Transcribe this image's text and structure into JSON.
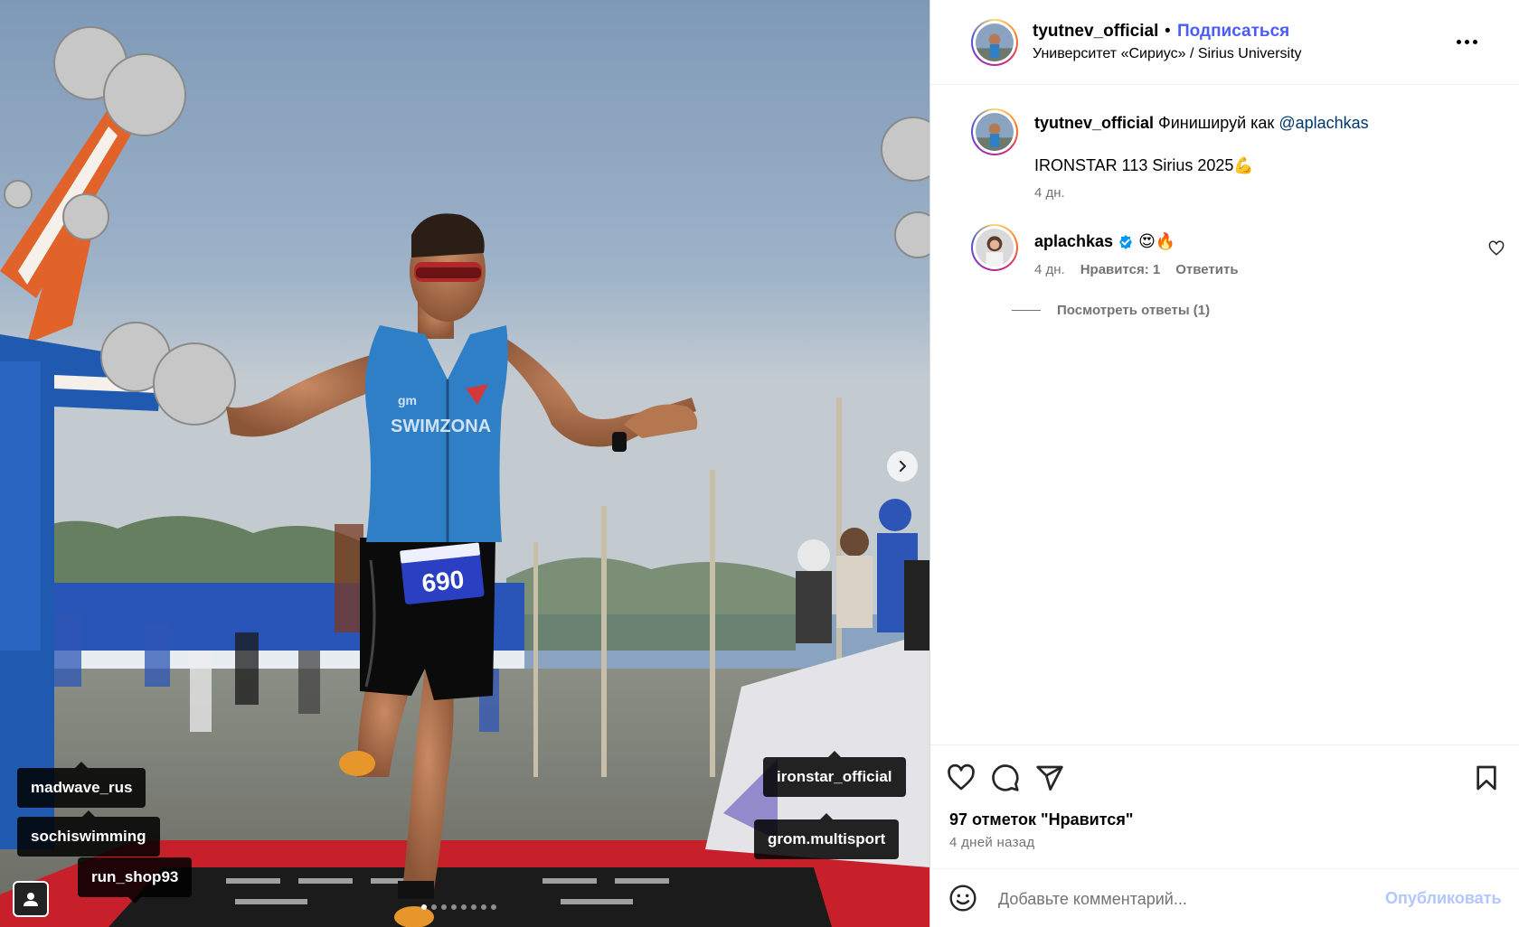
{
  "post": {
    "author": "tyutnev_official",
    "separator": "•",
    "follow_label": "Подписаться",
    "location": "Университет «Сириус» / Sirius University"
  },
  "caption": {
    "author": "tyutnev_official",
    "text": "Финишируй как",
    "mention": "@aplachkas",
    "line2": "IRONSTAR 113 Sirius 2025💪",
    "time": "4 дн."
  },
  "comment": {
    "author": "aplachkas",
    "verified_icon": "verified-badge-icon",
    "text": "😍🔥",
    "time": "4 дн.",
    "likes": "Нравится: 1",
    "reply_label": "Ответить",
    "view_replies": "Посмотреть ответы (1)"
  },
  "footer": {
    "likes_text": "97 отметок \"Нравится\"",
    "time_ago": "4 дней назад",
    "comment_placeholder": "Добавьте комментарий...",
    "publish_label": "Опубликовать"
  },
  "photo_tags": {
    "tag1": "madwave_rus",
    "tag2": "sochiswimming",
    "tag3": "run_shop93",
    "tag4": "ironstar_official",
    "tag5": "grom.multisport"
  },
  "photo_text": {
    "bib_number": "690",
    "jersey_brand": "SWIMZONA"
  },
  "carousel": {
    "total": 8,
    "active": 1
  },
  "colors": {
    "accent_blue": "#4a5df9",
    "mention_blue": "#00376b",
    "meta_gray": "#737373",
    "publish_disabled": "#b3c7ff",
    "verified_blue": "#0095f6"
  },
  "icons": {
    "like": "heart-icon",
    "comment": "comment-bubble-icon",
    "share": "paper-plane-icon",
    "save": "bookmark-icon",
    "more": "more-horizontal-icon",
    "next": "chevron-right-icon",
    "emoji": "smiley-icon",
    "user_tags": "person-icon"
  }
}
